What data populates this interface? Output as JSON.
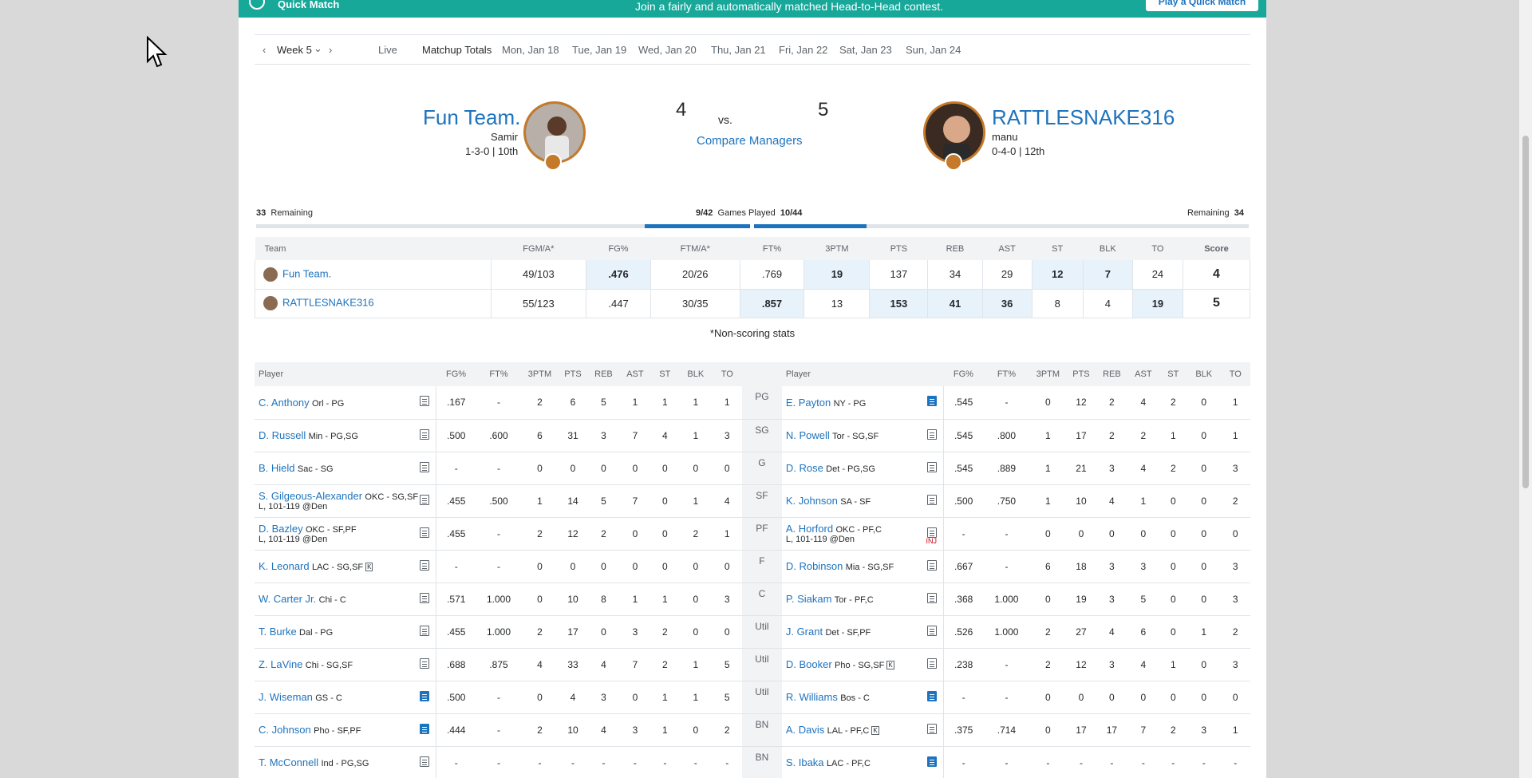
{
  "promo": {
    "title": "Quick Match",
    "text": "Join a fairly and automatically matched Head-to-Head contest.",
    "button": "Play a Quick Match"
  },
  "date_nav": {
    "prev": "‹",
    "week": "Week 5",
    "week_caret": "⌄",
    "next": "›",
    "tabs": [
      "Live",
      "Matchup Totals",
      "Mon, Jan 18",
      "Tue, Jan 19",
      "Wed, Jan 20",
      "Thu, Jan 21",
      "Fri, Jan 22",
      "Sat, Jan 23",
      "Sun, Jan 24"
    ]
  },
  "matchup": {
    "left": {
      "team": "Fun Team.",
      "manager": "Samir",
      "record": "1-3-0 | 10th",
      "score": "4"
    },
    "right": {
      "team": "RATTLESNAKE316",
      "manager": "manu",
      "record": "0-4-0 | 12th",
      "score": "5"
    },
    "vs": "vs.",
    "compare": "Compare Managers"
  },
  "games": {
    "left_remaining": "33",
    "remaining_label": "Remaining",
    "left_played": "9/42",
    "played_label": "Games Played",
    "right_played": "10/44",
    "right_remaining": "34",
    "left_fill": 0.214,
    "right_fill": 0.227
  },
  "summary": {
    "headers": [
      "Team",
      "FGM/A*",
      "FG%",
      "FTM/A*",
      "FT%",
      "3PTM",
      "PTS",
      "REB",
      "AST",
      "ST",
      "BLK",
      "TO",
      "Score"
    ],
    "rows": [
      {
        "team": "Fun Team.",
        "cells": [
          "49/103",
          ".476",
          "20/26",
          ".769",
          "19",
          "137",
          "34",
          "29",
          "12",
          "7",
          "24",
          "4"
        ],
        "win": [
          false,
          true,
          false,
          false,
          true,
          false,
          false,
          false,
          true,
          true,
          false,
          false
        ]
      },
      {
        "team": "RATTLESNAKE316",
        "cells": [
          "55/123",
          ".447",
          "30/35",
          ".857",
          "13",
          "153",
          "41",
          "36",
          "8",
          "4",
          "19",
          "5"
        ],
        "win": [
          false,
          false,
          false,
          true,
          false,
          true,
          true,
          true,
          false,
          false,
          true,
          false
        ]
      }
    ],
    "note": "*Non-scoring stats"
  },
  "players": {
    "left_headers": [
      "Player",
      "FG%",
      "FT%",
      "3PTM",
      "PTS",
      "REB",
      "AST",
      "ST",
      "BLK",
      "TO"
    ],
    "right_headers": [
      "Player",
      "FG%",
      "FT%",
      "3PTM",
      "PTS",
      "REB",
      "AST",
      "ST",
      "BLK",
      "TO"
    ],
    "rows": [
      {
        "pos": "PG",
        "l": {
          "name": "C. Anthony",
          "team": "Orl - PG",
          "game": "",
          "keeper": "",
          "blue": false,
          "stats": [
            ".167",
            "-",
            "2",
            "6",
            "5",
            "1",
            "1",
            "1",
            "1"
          ]
        },
        "r": {
          "name": "E. Payton",
          "team": "NY - PG",
          "game": "",
          "keeper": "",
          "blue": true,
          "inj": "",
          "stats": [
            ".545",
            "-",
            "0",
            "12",
            "2",
            "4",
            "2",
            "0",
            "1"
          ]
        }
      },
      {
        "pos": "SG",
        "l": {
          "name": "D. Russell",
          "team": "Min - PG,SG",
          "game": "",
          "keeper": "",
          "blue": false,
          "stats": [
            ".500",
            ".600",
            "6",
            "31",
            "3",
            "7",
            "4",
            "1",
            "3"
          ]
        },
        "r": {
          "name": "N. Powell",
          "team": "Tor - SG,SF",
          "game": "",
          "keeper": "",
          "blue": false,
          "inj": "",
          "stats": [
            ".545",
            ".800",
            "1",
            "17",
            "2",
            "2",
            "1",
            "0",
            "1"
          ]
        }
      },
      {
        "pos": "G",
        "l": {
          "name": "B. Hield",
          "team": "Sac - SG",
          "game": "",
          "keeper": "",
          "blue": false,
          "stats": [
            "-",
            "-",
            "0",
            "0",
            "0",
            "0",
            "0",
            "0",
            "0"
          ]
        },
        "r": {
          "name": "D. Rose",
          "team": "Det - PG,SG",
          "game": "",
          "keeper": "",
          "blue": false,
          "inj": "",
          "stats": [
            ".545",
            ".889",
            "1",
            "21",
            "3",
            "4",
            "2",
            "0",
            "3"
          ]
        }
      },
      {
        "pos": "SF",
        "l": {
          "name": "S. Gilgeous-Alexander",
          "team": "OKC - SG,SF",
          "game": "L, 101-119 @Den",
          "keeper": "",
          "blue": false,
          "stats": [
            ".455",
            ".500",
            "1",
            "14",
            "5",
            "7",
            "0",
            "1",
            "4"
          ]
        },
        "r": {
          "name": "K. Johnson",
          "team": "SA - SF",
          "game": "",
          "keeper": "",
          "blue": false,
          "inj": "",
          "stats": [
            ".500",
            ".750",
            "1",
            "10",
            "4",
            "1",
            "0",
            "0",
            "2"
          ]
        }
      },
      {
        "pos": "PF",
        "l": {
          "name": "D. Bazley",
          "team": "OKC - SF,PF",
          "game": "L, 101-119 @Den",
          "keeper": "",
          "blue": false,
          "stats": [
            ".455",
            "-",
            "2",
            "12",
            "2",
            "0",
            "0",
            "2",
            "1"
          ]
        },
        "r": {
          "name": "A. Horford",
          "team": "OKC - PF,C",
          "game": "L, 101-119 @Den",
          "keeper": "",
          "blue": false,
          "inj": "INJ",
          "stats": [
            "-",
            "-",
            "0",
            "0",
            "0",
            "0",
            "0",
            "0",
            "0"
          ]
        }
      },
      {
        "pos": "F",
        "l": {
          "name": "K. Leonard",
          "team": "LAC - SG,SF",
          "game": "",
          "keeper": "K",
          "blue": false,
          "stats": [
            "-",
            "-",
            "0",
            "0",
            "0",
            "0",
            "0",
            "0",
            "0"
          ]
        },
        "r": {
          "name": "D. Robinson",
          "team": "Mia - SG,SF",
          "game": "",
          "keeper": "",
          "blue": false,
          "inj": "",
          "stats": [
            ".667",
            "-",
            "6",
            "18",
            "3",
            "3",
            "0",
            "0",
            "3"
          ]
        }
      },
      {
        "pos": "C",
        "l": {
          "name": "W. Carter Jr.",
          "team": "Chi - C",
          "game": "",
          "keeper": "",
          "blue": false,
          "stats": [
            ".571",
            "1.000",
            "0",
            "10",
            "8",
            "1",
            "1",
            "0",
            "3"
          ]
        },
        "r": {
          "name": "P. Siakam",
          "team": "Tor - PF,C",
          "game": "",
          "keeper": "",
          "blue": false,
          "inj": "",
          "stats": [
            ".368",
            "1.000",
            "0",
            "19",
            "3",
            "5",
            "0",
            "0",
            "3"
          ]
        }
      },
      {
        "pos": "Util",
        "l": {
          "name": "T. Burke",
          "team": "Dal - PG",
          "game": "",
          "keeper": "",
          "blue": false,
          "stats": [
            ".455",
            "1.000",
            "2",
            "17",
            "0",
            "3",
            "2",
            "0",
            "0"
          ]
        },
        "r": {
          "name": "J. Grant",
          "team": "Det - SF,PF",
          "game": "",
          "keeper": "",
          "blue": false,
          "inj": "",
          "stats": [
            ".526",
            "1.000",
            "2",
            "27",
            "4",
            "6",
            "0",
            "1",
            "2"
          ]
        }
      },
      {
        "pos": "Util",
        "l": {
          "name": "Z. LaVine",
          "team": "Chi - SG,SF",
          "game": "",
          "keeper": "",
          "blue": false,
          "stats": [
            ".688",
            ".875",
            "4",
            "33",
            "4",
            "7",
            "2",
            "1",
            "5"
          ]
        },
        "r": {
          "name": "D. Booker",
          "team": "Pho - SG,SF",
          "game": "",
          "keeper": "K",
          "blue": false,
          "inj": "",
          "stats": [
            ".238",
            "-",
            "2",
            "12",
            "3",
            "4",
            "1",
            "0",
            "3"
          ]
        }
      },
      {
        "pos": "Util",
        "l": {
          "name": "J. Wiseman",
          "team": "GS - C",
          "game": "",
          "keeper": "",
          "blue": true,
          "stats": [
            ".500",
            "-",
            "0",
            "4",
            "3",
            "0",
            "1",
            "1",
            "5"
          ]
        },
        "r": {
          "name": "R. Williams",
          "team": "Bos - C",
          "game": "",
          "keeper": "",
          "blue": true,
          "inj": "",
          "stats": [
            "-",
            "-",
            "0",
            "0",
            "0",
            "0",
            "0",
            "0",
            "0"
          ]
        }
      },
      {
        "pos": "BN",
        "l": {
          "name": "C. Johnson",
          "team": "Pho - SF,PF",
          "game": "",
          "keeper": "",
          "blue": true,
          "stats": [
            ".444",
            "-",
            "2",
            "10",
            "4",
            "3",
            "1",
            "0",
            "2"
          ]
        },
        "r": {
          "name": "A. Davis",
          "team": "LAL - PF,C",
          "game": "",
          "keeper": "K",
          "blue": false,
          "inj": "",
          "stats": [
            ".375",
            ".714",
            "0",
            "17",
            "17",
            "7",
            "2",
            "3",
            "1"
          ]
        }
      },
      {
        "pos": "BN",
        "l": {
          "name": "T. McConnell",
          "team": "Ind - PG,SG",
          "game": "",
          "keeper": "",
          "blue": false,
          "stats": [
            "-",
            "-",
            "-",
            "-",
            "-",
            "-",
            "-",
            "-",
            "-"
          ]
        },
        "r": {
          "name": "S. Ibaka",
          "team": "LAC - PF,C",
          "game": "",
          "keeper": "",
          "blue": true,
          "inj": "",
          "stats": [
            "-",
            "-",
            "-",
            "-",
            "-",
            "-",
            "-",
            "-",
            "-"
          ]
        }
      }
    ]
  },
  "colors": {
    "accent": "#1e73be",
    "promo": "#17a89a",
    "avatar_ring": "#c47a2a",
    "win_bg": "#e8f2fb"
  }
}
